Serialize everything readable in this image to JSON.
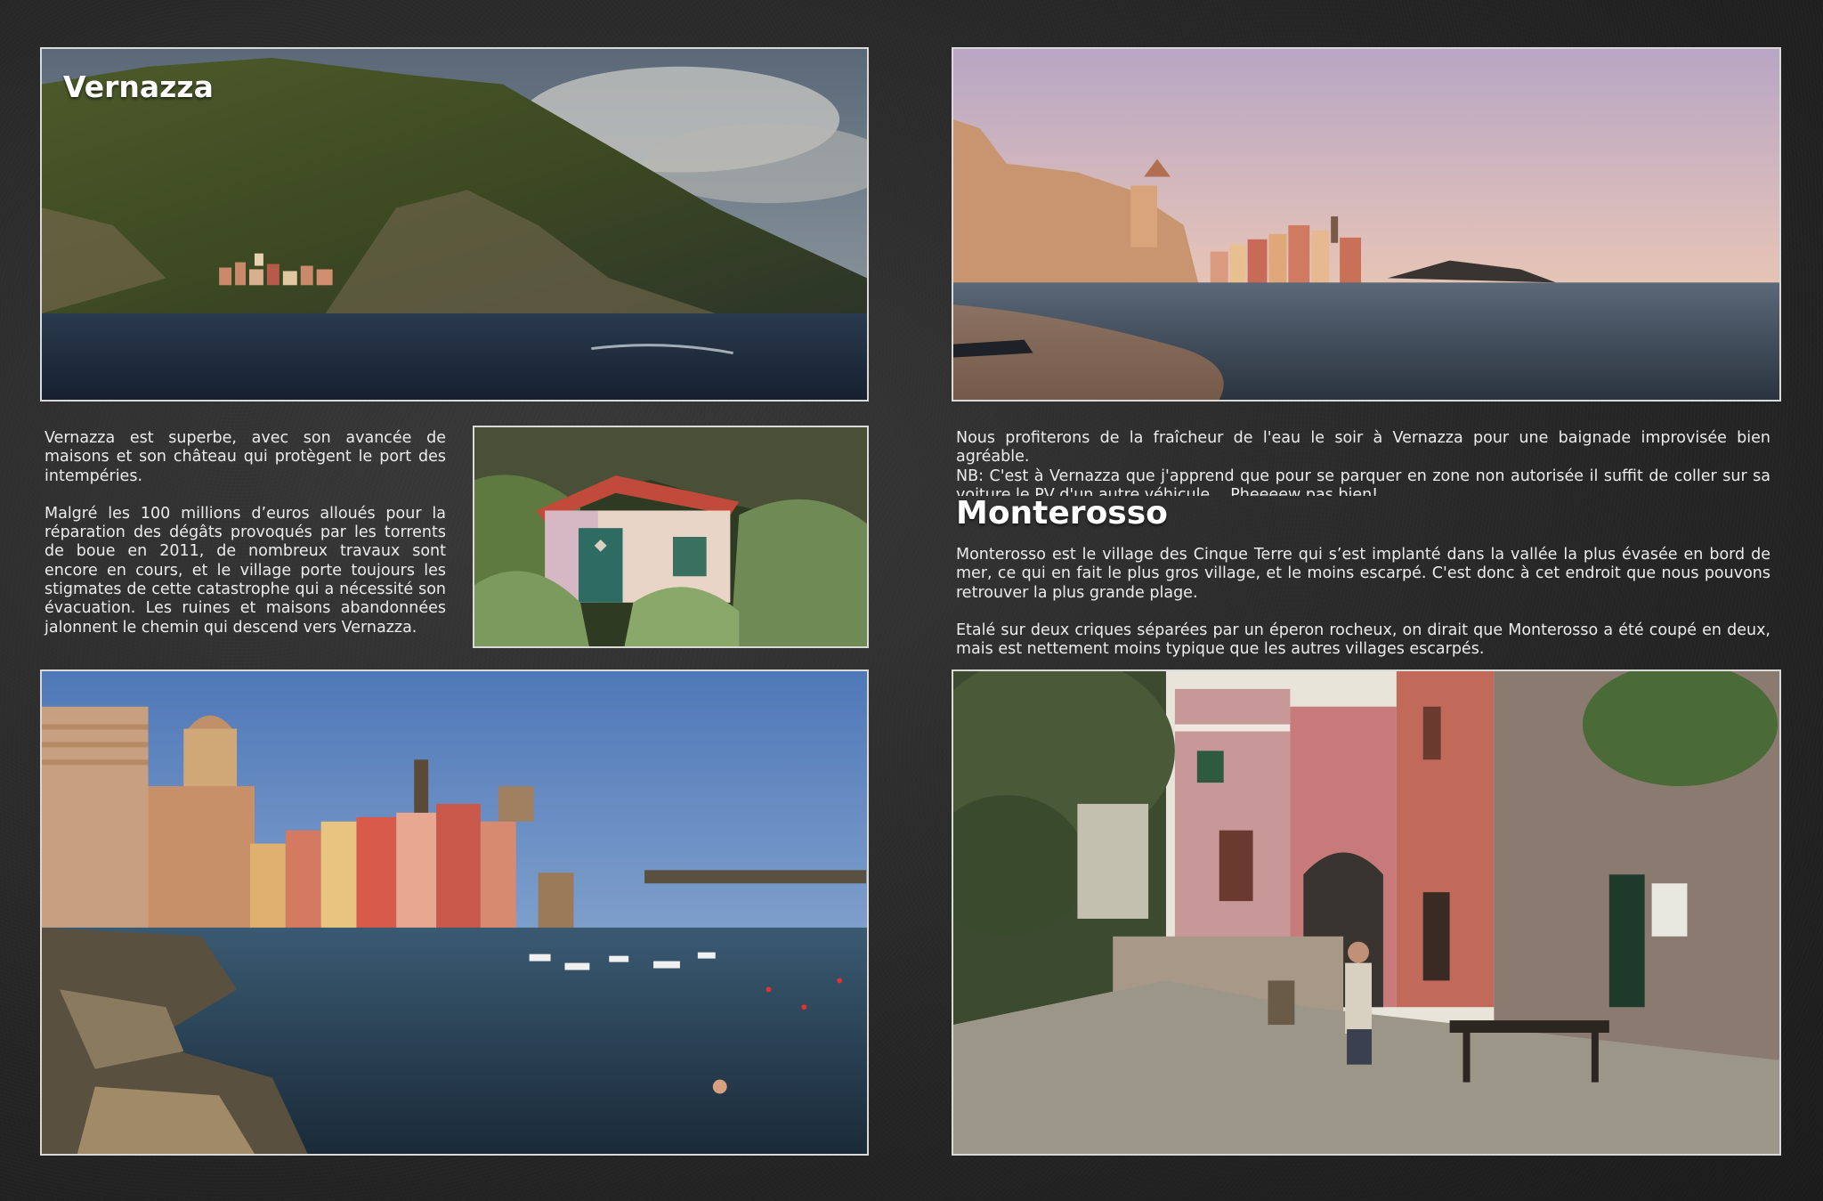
{
  "left_page": {
    "title": "Vernazza",
    "intro_text": "Vernazza est superbe, avec son avancée de maisons et son château qui protègent le port des intempéries.",
    "body_text": "Malgré les 100 millions d’euros alloués pour la réparation des dégâts provoqués par les torrents de boue en 2011, de nombreux travaux sont encore en cours, et le village porte toujours les stigmates de cette catastrophe qui a nécessité son évacuation. Les ruines et maisons abandonnées jalonnent le chemin qui descend vers Vernazza."
  },
  "right_page": {
    "swim_text": "Nous profiterons de la fraîcheur de l'eau le soir à Vernazza pour une baignade improvisée bien agréable.",
    "note_text": "NB: C'est à Vernazza que j'apprend que pour se parquer en zone non autorisée il suffit de coller sur sa voiture le PV d'un autre véhicule… Pheeeew pas bien!",
    "title": "Monterosso",
    "para1": "Monterosso est le village des Cinque Terre qui s’est implanté dans la vallée la plus évasée en bord de mer, ce qui en fait le plus gros village, et le moins escarpé. C'est donc à cet endroit que nous pouvons retrouver  la plus grande plage.",
    "para2": "Etalé sur deux criques séparées par un éperon rocheux, on dirait que Monterosso a été coupé en deux, mais est nettement moins typique que les autres villages escarpés."
  },
  "photos": {
    "p1": "vernazza-coast-mountain-photo",
    "p2": "vernazza-harbor-sunset-photo",
    "p3": "abandoned-cabin-photo",
    "p4": "vernazza-bay-swimmer-photo",
    "p5": "monterosso-street-photo"
  }
}
